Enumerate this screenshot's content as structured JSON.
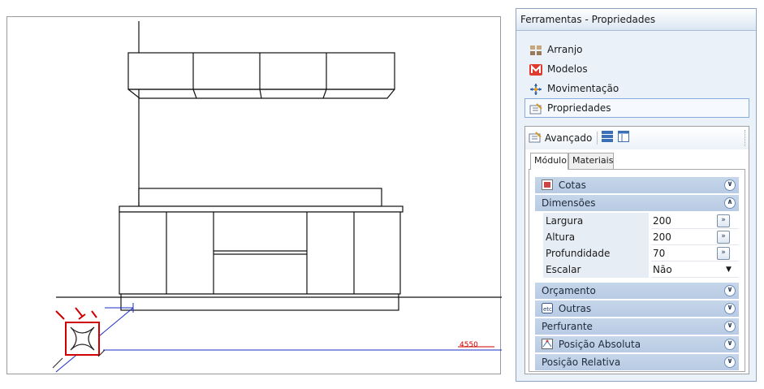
{
  "viewport": {
    "dimension_label": "4550"
  },
  "panel": {
    "title": "Ferramentas - Propriedades",
    "nav": [
      {
        "label": "Arranjo",
        "icon": "arrangement-icon"
      },
      {
        "label": "Modelos",
        "icon": "models-icon"
      },
      {
        "label": "Movimentação",
        "icon": "move-icon"
      },
      {
        "label": "Propriedades",
        "icon": "properties-icon",
        "selected": true
      }
    ],
    "toolbar": {
      "advanced_label": "Avançado"
    },
    "tabs": [
      "Módulo",
      "Materiais"
    ],
    "groups": {
      "cotas": "Cotas",
      "dimensoes": "Dimensões",
      "orcamento": "Orçamento",
      "outras": "Outras",
      "perfurante": "Perfurante",
      "posicao_absoluta": "Posição Absoluta",
      "posicao_relativa": "Posição Relativa"
    },
    "properties": [
      {
        "label": "Largura",
        "value": "200"
      },
      {
        "label": "Altura",
        "value": "200"
      },
      {
        "label": "Profundidade",
        "value": "70"
      },
      {
        "label": "Escalar",
        "value": "Não"
      }
    ],
    "accent_color": "#84acdd",
    "group_color": "#c6d6ea"
  }
}
